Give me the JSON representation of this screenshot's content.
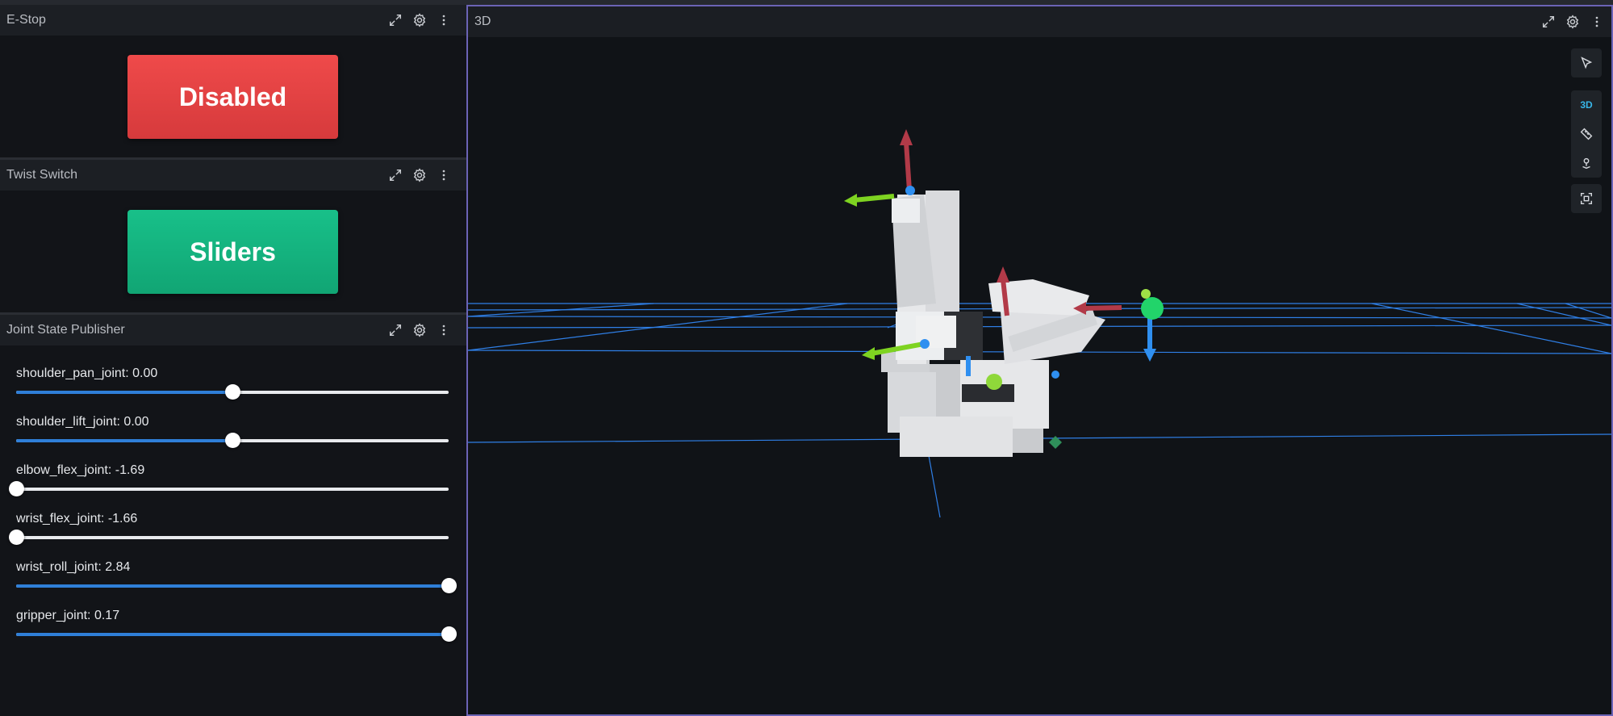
{
  "panels": {
    "estop": {
      "title": "E-Stop",
      "button_label": "Disabled",
      "button_color": "#e04244"
    },
    "twist": {
      "title": "Twist Switch",
      "button_label": "Sliders",
      "button_color": "#14b37f"
    },
    "joints": {
      "title": "Joint State Publisher",
      "sliders": [
        {
          "label": "shoulder_pan_joint: 0.00",
          "fraction": 0.5
        },
        {
          "label": "shoulder_lift_joint: 0.00",
          "fraction": 0.5
        },
        {
          "label": "elbow_flex_joint: -1.69",
          "fraction": 0.0
        },
        {
          "label": "wrist_flex_joint: -1.66",
          "fraction": 0.0
        },
        {
          "label": "wrist_roll_joint: 2.84",
          "fraction": 1.0
        },
        {
          "label": "gripper_joint: 0.17",
          "fraction": 1.0
        }
      ]
    },
    "view3d": {
      "title": "3D",
      "tools": {
        "mode_label": "3D"
      }
    }
  },
  "colors": {
    "accent": "#2f7fd8",
    "grid": "#2f7fe6",
    "axis_red": "#b23a48",
    "axis_green": "#7ed321",
    "axis_blue": "#2f8ff0",
    "panel_focus_border": "#6b63b5"
  },
  "icons": [
    "expand-icon",
    "gear-icon",
    "more-vertical-icon",
    "cursor-select-icon",
    "ruler-icon",
    "publish-point-icon",
    "fit-view-icon"
  ]
}
